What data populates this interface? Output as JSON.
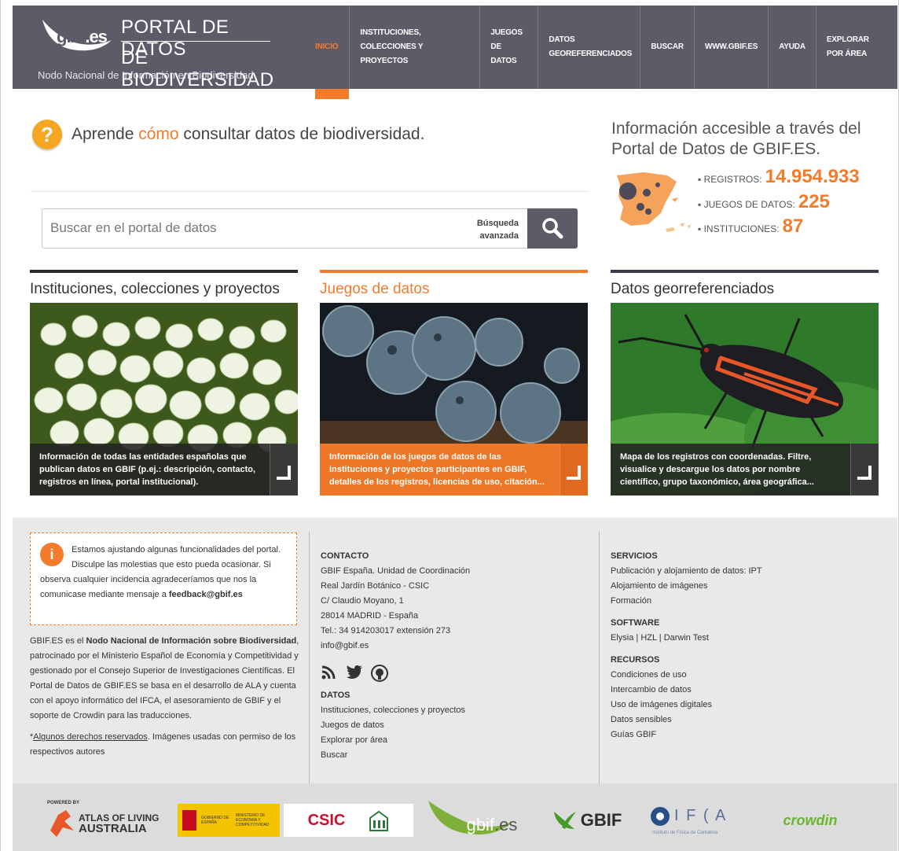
{
  "header": {
    "logo_gbif": "gbif",
    "logo_es": ".es",
    "title_line1": "PORTAL DE DATOS",
    "title_line2": "DE BIODIVERSIDAD",
    "subtitle": "Nodo Nacional de Información en Biodiversidad",
    "nav": [
      {
        "label": "INICIO",
        "active": true
      },
      {
        "label": "INSTITUCIONES, COLECCIONES Y PROYECTOS"
      },
      {
        "label": "JUEGOS DE DATOS"
      },
      {
        "label": "DATOS GEOREFERENCIADOS"
      },
      {
        "label": "BUSCAR"
      },
      {
        "label": "WWW.GBIF.ES"
      },
      {
        "label": "AYUDA"
      },
      {
        "label": "EXPLORAR POR ÁREA"
      }
    ]
  },
  "help": {
    "before": "Aprende ",
    "highlight": "cómo",
    "after": " consultar datos de biodiversidad."
  },
  "search": {
    "placeholder": "Buscar en el portal de datos",
    "advanced_line1": "Búsqueda",
    "advanced_line2": "avanzada"
  },
  "stats": {
    "title": "Información accesible a través del Portal de Datos de GBIF.ES.",
    "items": [
      {
        "label": "REGISTROS:",
        "value": "14.954.933"
      },
      {
        "label": "JUEGOS DE DATOS:",
        "value": "225"
      },
      {
        "label": "INSTITUCIONES:",
        "value": "87"
      }
    ]
  },
  "cards": [
    {
      "title": "Instituciones, colecciones y proyectos",
      "caption": "Información de todas las entidades españolas que publican datos en GBIF (p.ej.: descripción, contacto, registros en línea, portal institucional)."
    },
    {
      "title": "Juegos de datos",
      "caption": "Información de los juegos de datos de las instituciones y proyectos participantes en GBIF, detalles de los registros, licencias de uso, citación..."
    },
    {
      "title": "Datos georreferenciados",
      "caption": "Mapa de los registros con coordenadas. Filtre, visualice y descargue los datos por nombre científico, grupo taxonómico, área geográfica..."
    }
  ],
  "footer": {
    "notice_text": "Estamos ajustando algunas funcionalidades del portal. Disculpe las molestias que esto pueda ocasionar. Si observa cualquier incidencia agradeceríamos que nos la comunicase mediante mensaje a ",
    "notice_email": "feedback@gbif.es",
    "about_1": "GBIF.ES es el ",
    "about_bold": "Nodo Nacional de Información sobre Biodiversidad",
    "about_2": ", patrocinado por el Ministerio Español de Economía y Competitividad y gestionado por el Consejo Superior de Investigaciones Científicas. El Portal de Datos de GBIF.ES se basa en el desarrollo de ALA y cuenta con el apoyo informático del IFCA, el asesoramiento de GBIF y el soporte de Crowdin para las traducciones.",
    "rights_star": "*",
    "rights_link": "Algunos derechos reservados",
    "rights_rest": ". Imágenes usadas con permiso de los respectivos autores",
    "contact_heading": "CONTACTO",
    "contact_lines": [
      "GBIF España. Unidad de Coordinación",
      "Real Jardín Botánico - CSIC",
      "C/ Claudio Moyano, 1",
      "28014 MADRID - España",
      "Tel.: 34 914203017 extensión 273",
      "info@gbif.es"
    ],
    "datos_heading": "DATOS",
    "datos_links": [
      "Instituciones, colecciones y proyectos",
      "Juegos de datos",
      "Explorar por área",
      "Buscar"
    ],
    "servicios_heading": "SERVICIOS",
    "servicios_links": [
      "Publicación y alojamiento de datos: IPT",
      "Alojamiento de imágenes",
      "Formación"
    ],
    "software_heading": "SOFTWARE",
    "software_links": [
      "Elysia",
      "HZL",
      "Darwin Test"
    ],
    "software_sep": " | ",
    "recursos_heading": "RECURSOS",
    "recursos_links": [
      "Condiciones de uso",
      "Intercambio de datos",
      "Uso de imágenes digitales",
      "Datos sensibles",
      "Guías GBIF"
    ]
  },
  "sponsors": {
    "ala_powered": "POWERED BY",
    "ala_line1": "ATLAS OF LIVING",
    "ala_line2": "AUSTRALIA",
    "gob_text": "GOBIERNO DE ESPAÑA",
    "min_text": "MINISTERIO DE ECONOMÍA Y COMPETITIVIDAD",
    "csic": "CSIC",
    "gbifes_gbif": "gbif",
    "gbifes_es": ".es",
    "gbif": "GBIF",
    "ifca": "I F ( A",
    "ifca_sub": "Instituto de Física de Cantabria",
    "crowdin": "crowdin"
  },
  "colors": {
    "accent": "#f47b2a",
    "header": "#5f5a68",
    "footer": "#e9e9e9"
  }
}
